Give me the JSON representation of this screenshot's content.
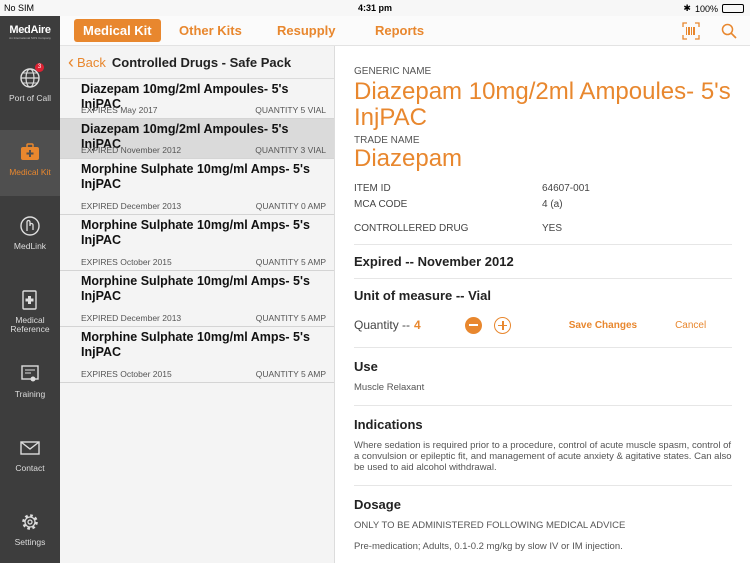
{
  "status": {
    "carrier": "No SIM",
    "time": "4:31 pm",
    "battery": "100%"
  },
  "logo": {
    "text": "MedAire",
    "sub": "An International SOS Company"
  },
  "sidebar": {
    "items": [
      {
        "label": "Port of Call",
        "badge": "3"
      },
      {
        "label": "Medical Kit"
      },
      {
        "label": "MedLink"
      },
      {
        "label": "Medical Reference"
      },
      {
        "label": "Training"
      },
      {
        "label": "Contact"
      },
      {
        "label": "Settings"
      }
    ]
  },
  "tabs": [
    "Medical Kit",
    "Other Kits",
    "Resupply",
    "Reports"
  ],
  "list": {
    "back_label": "Back",
    "title": "Controlled Drugs - Safe Pack",
    "items": [
      {
        "name": "Diazepam 10mg/2ml Ampoules- 5's InjPAC",
        "expiry": "EXPIRES May 2017",
        "quantity": "QUANTITY 5 VIAL"
      },
      {
        "name": "Diazepam 10mg/2ml Ampoules- 5's InjPAC",
        "expiry": "EXPIRED November 2012",
        "quantity": "QUANTITY 3 VIAL"
      },
      {
        "name": "Morphine Sulphate 10mg/ml Amps-  5's InjPAC",
        "expiry": "EXPIRED December 2013",
        "quantity": "QUANTITY 0 AMP"
      },
      {
        "name": "Morphine Sulphate 10mg/ml Amps-  5's InjPAC",
        "expiry": "EXPIRES October 2015",
        "quantity": "QUANTITY 5 AMP"
      },
      {
        "name": "Morphine Sulphate 10mg/ml Amps-  5's InjPAC",
        "expiry": "EXPIRED December 2013",
        "quantity": "QUANTITY 5 AMP"
      },
      {
        "name": "Morphine Sulphate 10mg/ml Amps-  5's InjPAC",
        "expiry": "EXPIRES October 2015",
        "quantity": "QUANTITY 5 AMP"
      }
    ]
  },
  "detail": {
    "generic_label": "GENERIC NAME",
    "generic_name": "Diazepam 10mg/2ml Ampoules- 5's InjPAC",
    "trade_label": "TRADE NAME",
    "trade_name": "Diazepam",
    "item_id_label": "ITEM ID",
    "item_id": "64607-001",
    "mca_label": "MCA CODE",
    "mca": "4 (a)",
    "controlled_label": "CONTROLLERED DRUG",
    "controlled": "YES",
    "expired": "Expired -- November 2012",
    "unit": "Unit of measure -- Vial",
    "quantity_label": "Quantity --",
    "quantity_value": "4",
    "save_label": "Save Changes",
    "cancel_label": "Cancel",
    "use_heading": "Use",
    "use_text": "Muscle Relaxant",
    "indications_heading": "Indications",
    "indications_text": "Where sedation is required prior to a procedure, control of acute muscle spasm, control of a convulsion or epileptic fit, and management of acute anxiety & agitative states. Can also be used to aid alcohol withdrawal.",
    "dosage_heading": "Dosage",
    "dosage_text1": "ONLY TO BE ADMINISTERED FOLLOWING MEDICAL ADVICE",
    "dosage_text2": "Pre-medication; Adults, 0.1-0.2 mg/kg by slow IV or IM injection."
  },
  "colors": {
    "accent": "#e8872e",
    "sidebar": "#3d3d3d"
  }
}
